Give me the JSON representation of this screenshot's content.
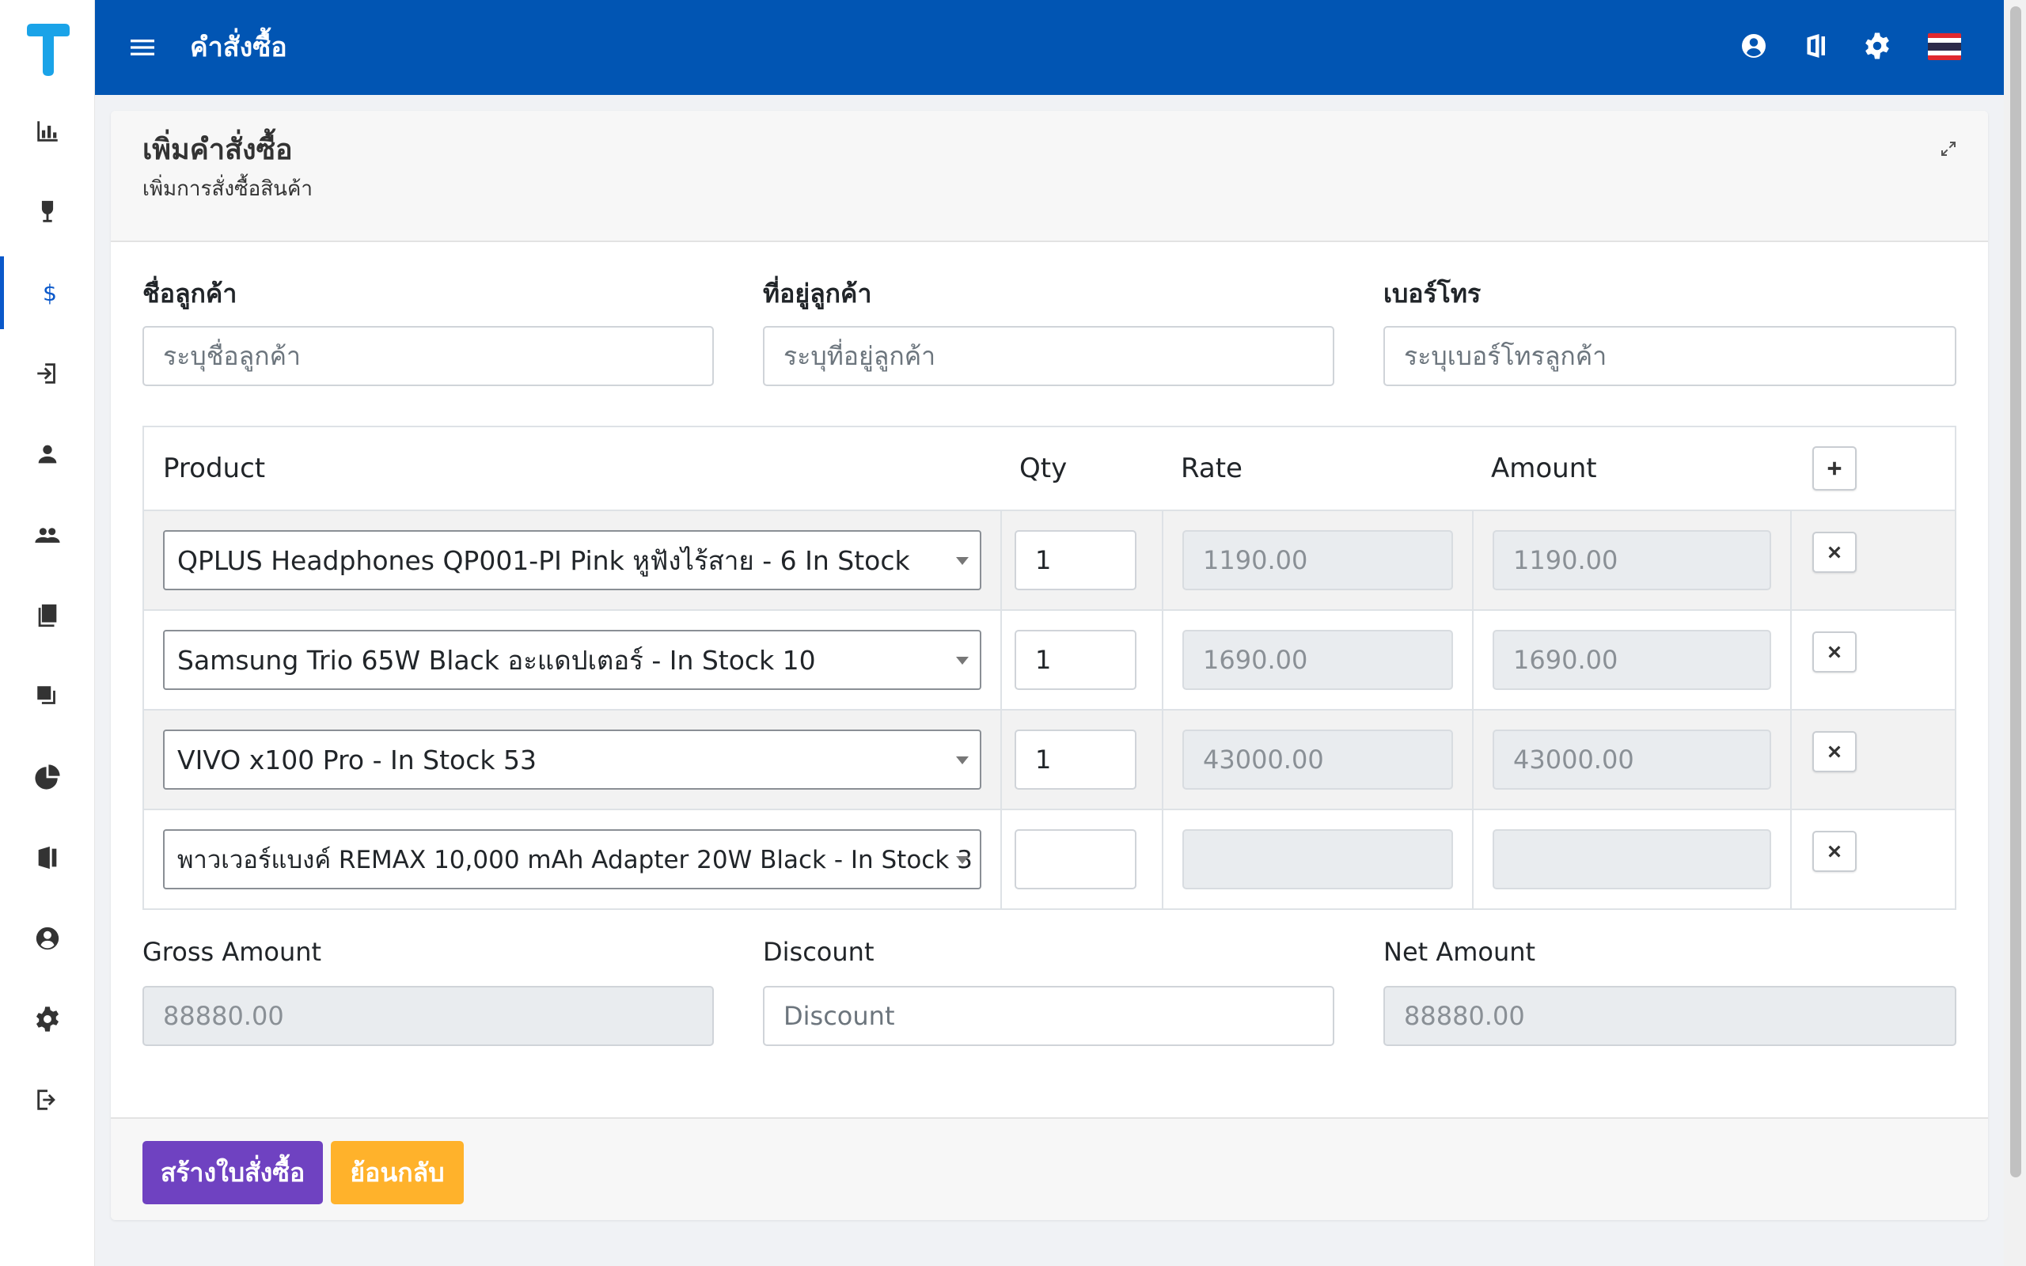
{
  "app": {
    "title": "คำสั่งซื้อ",
    "colors": {
      "topbar": "#0155b3",
      "accent": "#0a58ca",
      "create_button": "#6f42c1",
      "back_button": "#ffb22b"
    },
    "icons": [
      "menu-icon",
      "user-circle-icon",
      "office-icon",
      "gear-icon",
      "thai-flag-icon"
    ]
  },
  "sidebar": {
    "items": [
      {
        "name": "chart-icon"
      },
      {
        "name": "wine-glass-icon"
      },
      {
        "name": "dollar-icon",
        "active": true
      },
      {
        "name": "sign-in-icon"
      },
      {
        "name": "user-icon"
      },
      {
        "name": "users-icon"
      },
      {
        "name": "book-icon"
      },
      {
        "name": "clone-icon"
      },
      {
        "name": "pie-chart-icon"
      },
      {
        "name": "building-icon"
      },
      {
        "name": "account-circle-icon"
      },
      {
        "name": "settings-icon"
      },
      {
        "name": "logout-icon"
      }
    ]
  },
  "page": {
    "title": "เพิ่มคำสั่งซื้อ",
    "subtitle": "เพิ่มการสั่งซื้อสินค้า"
  },
  "customer": {
    "name_label": "ชื่อลูกค้า",
    "name_placeholder": "ระบุชื่อลูกค้า",
    "address_label": "ที่อยู่ลูกค้า",
    "address_placeholder": "ระบุที่อยู่ลูกค้า",
    "phone_label": "เบอร์โทร",
    "phone_placeholder": "ระบุเบอร์โทรลูกค้า"
  },
  "table": {
    "headers": {
      "product": "Product",
      "qty": "Qty",
      "rate": "Rate",
      "amount": "Amount"
    },
    "rows": [
      {
        "product": "QPLUS Headphones QP001-PI Pink หูฟังไร้สาย - 6 In Stock",
        "qty": "1",
        "rate": "1190.00",
        "amount": "1190.00"
      },
      {
        "product": "Samsung Trio 65W Black อะแดปเตอร์ - In Stock 10",
        "qty": "1",
        "rate": "1690.00",
        "amount": "1690.00"
      },
      {
        "product": "VIVO x100 Pro - In Stock 53",
        "qty": "1",
        "rate": "43000.00",
        "amount": "43000.00"
      },
      {
        "product": "พาวเวอร์แบงค์ REMAX 10,000 mAh Adapter 20W Black - In Stock 3",
        "qty": "",
        "rate": "",
        "amount": ""
      }
    ]
  },
  "totals": {
    "gross_label": "Gross Amount",
    "gross_value": "88880.00",
    "discount_label": "Discount",
    "discount_placeholder": "Discount",
    "net_label": "Net Amount",
    "net_value": "88880.00"
  },
  "actions": {
    "create_label": "สร้างใบสั่งซื้อ",
    "back_label": "ย้อนกลับ"
  }
}
